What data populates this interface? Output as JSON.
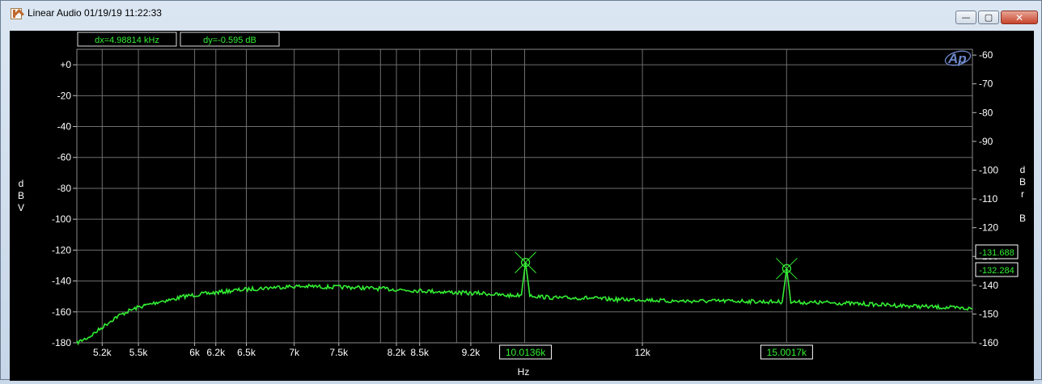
{
  "window": {
    "title": "Linear Audio  01/19/19 11:22:33",
    "minimize_label": "—",
    "maximize_label": "▢",
    "close_label": "✕"
  },
  "readouts": {
    "dx": "dx=4.98814 kHz",
    "dy": "dy=-0.595  dB"
  },
  "logo_text": "Ap",
  "colors": {
    "trace": "#33ee33",
    "grid": "#6e6e6e",
    "background": "#000000",
    "text": "#ffffff"
  },
  "chart_data": {
    "type": "line",
    "title": "",
    "xlabel": "Hz",
    "ylabel_left": "d\nB\nV",
    "ylabel_right": "d\nB\nr\n\nB",
    "xscale": "log",
    "xlim": [
      5000,
      20000
    ],
    "ylim_left": [
      -180,
      10
    ],
    "ylim_right": [
      -160,
      -58
    ],
    "grid": true,
    "x_tick_labels": [
      {
        "value": 5200,
        "label": "5.2k"
      },
      {
        "value": 5500,
        "label": "5.5k"
      },
      {
        "value": 6000,
        "label": "6k"
      },
      {
        "value": 6200,
        "label": "6.2k"
      },
      {
        "value": 6500,
        "label": "6.5k"
      },
      {
        "value": 7000,
        "label": "7k"
      },
      {
        "value": 7500,
        "label": "7.5k"
      },
      {
        "value": 8200,
        "label": "8.2k"
      },
      {
        "value": 8500,
        "label": "8.5k"
      },
      {
        "value": 9200,
        "label": "9.2k"
      },
      {
        "value": 12000,
        "label": "12k"
      }
    ],
    "x_grid_values": [
      5200,
      5500,
      6000,
      6200,
      6500,
      7000,
      7500,
      8000,
      8200,
      8500,
      9000,
      9200,
      9500,
      10000,
      12000,
      15000,
      20000
    ],
    "y_left_ticks": [
      {
        "value": 0,
        "label": "+0"
      },
      {
        "value": -20,
        "label": "-20"
      },
      {
        "value": -40,
        "label": "-40"
      },
      {
        "value": -60,
        "label": "-60"
      },
      {
        "value": -80,
        "label": "-80"
      },
      {
        "value": -100,
        "label": "-100"
      },
      {
        "value": -120,
        "label": "-120"
      },
      {
        "value": -140,
        "label": "-140"
      },
      {
        "value": -160,
        "label": "-160"
      },
      {
        "value": -180,
        "label": "-180"
      }
    ],
    "y_right_ticks": [
      {
        "value": -60,
        "label": "-60"
      },
      {
        "value": -70,
        "label": "-70"
      },
      {
        "value": -80,
        "label": "-80"
      },
      {
        "value": -90,
        "label": "-90"
      },
      {
        "value": -100,
        "label": "-100"
      },
      {
        "value": -110,
        "label": "-110"
      },
      {
        "value": -120,
        "label": "-120"
      },
      {
        "value": -130,
        "label": "-130"
      },
      {
        "value": -140,
        "label": "-140"
      },
      {
        "value": -150,
        "label": "-150"
      },
      {
        "value": -160,
        "label": "-160"
      }
    ],
    "series": [
      {
        "x": [
          5000,
          5050,
          5100,
          5150,
          5200,
          5300,
          5400,
          5500,
          5600,
          5700,
          5800,
          5900,
          6000,
          6200,
          6400,
          6600,
          6800,
          7000,
          7200,
          7400,
          7600,
          7800,
          8000,
          8200,
          8400,
          8600,
          8800,
          9000,
          9200,
          9400,
          9600,
          9800,
          9950,
          10013.6,
          10080,
          10200,
          10500,
          11000,
          11500,
          12000,
          12500,
          13000,
          13500,
          14000,
          14500,
          14900,
          15001.7,
          15100,
          15500,
          16000,
          17000,
          18000,
          19000,
          20000
        ],
        "y": [
          -180,
          -178,
          -176,
          -173,
          -170,
          -164,
          -160,
          -157,
          -155,
          -153,
          -152,
          -150,
          -149,
          -147.5,
          -146,
          -145,
          -144,
          -143.5,
          -143.5,
          -144,
          -144,
          -144.5,
          -145,
          -145.5,
          -146,
          -146.5,
          -147,
          -147.5,
          -148,
          -148,
          -149,
          -149.5,
          -149,
          -128,
          -149,
          -150,
          -151,
          -151,
          -152,
          -152,
          -153,
          -153,
          -153,
          -153,
          -153.5,
          -153.5,
          -132,
          -153.5,
          -154,
          -154,
          -155,
          -156,
          -157,
          -158
        ]
      }
    ],
    "markers": [
      {
        "x": 10013.6,
        "y": -128,
        "x_label": "10.0136k",
        "right_label": "-131.688"
      },
      {
        "x": 15001.7,
        "y": -132,
        "x_label": "15.0017k",
        "right_label": "-132.284"
      }
    ]
  }
}
